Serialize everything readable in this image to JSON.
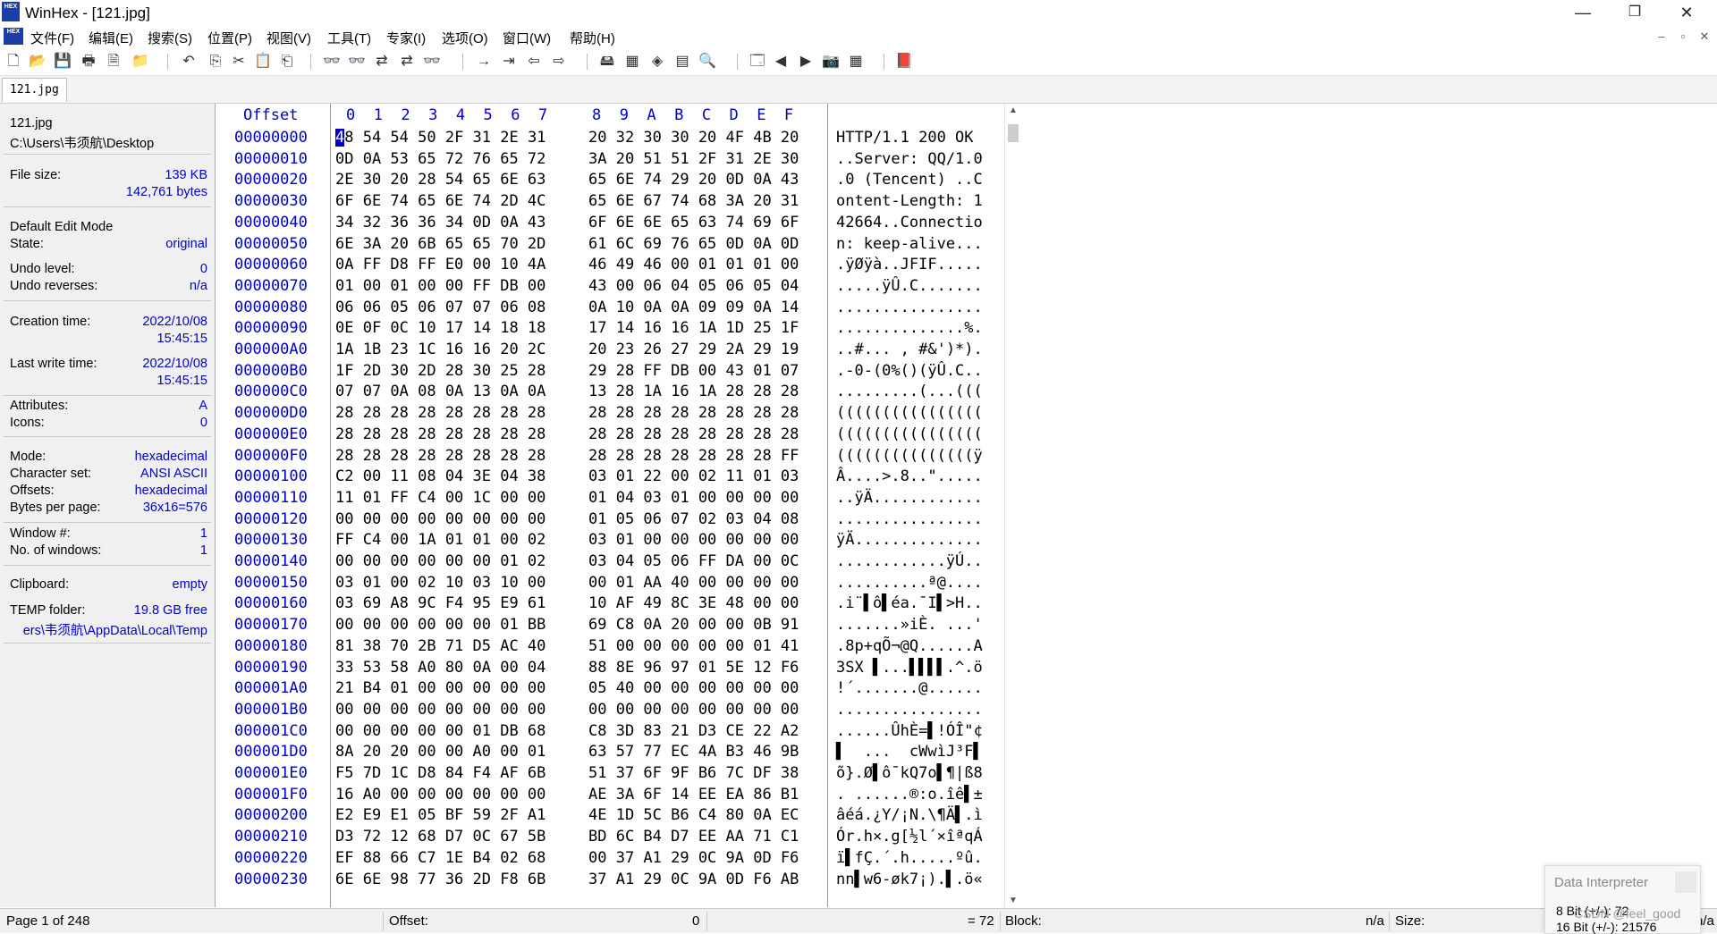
{
  "window": {
    "app_icon_text": "HEX",
    "title": "WinHex - [121.jpg]",
    "minimize": "—",
    "restore": "❐",
    "close": "✕"
  },
  "menu": {
    "items": [
      "文件(F)",
      "编辑(E)",
      "搜索(S)",
      "位置(P)",
      "视图(V)",
      "工具(T)",
      "专家(I)",
      "选项(O)",
      "窗口(W)",
      "帮助(H)"
    ],
    "mdi_min": "–",
    "mdi_restore": "▫",
    "mdi_close": "✕"
  },
  "toolbar": {
    "icons": [
      "new-file-icon",
      "open-file-icon",
      "save-icon",
      "print-icon",
      "properties-icon",
      "open-folder-icon",
      "undo-icon",
      "copy-icon",
      "cut-icon",
      "paste-icon",
      "copy-hex-icon",
      "find-text-icon",
      "find-hex-icon",
      "replace-text-icon",
      "replace-hex-icon",
      "find-again-icon",
      "goto-offset-icon",
      "goto-sector-icon",
      "back-icon",
      "forward-icon",
      "open-disk-icon",
      "open-ram-icon",
      "disk-tools-icon",
      "calculator-icon",
      "analyze-icon",
      "disk-snapshot-icon",
      "prev-icon",
      "next-icon",
      "camera-icon",
      "grid-icon",
      "help-book-icon"
    ],
    "glyphs": [
      "🗋",
      "📂",
      "💾",
      "🖶",
      "🗎",
      "📁",
      "↶",
      "⎘",
      "✂",
      "📋",
      "⎗",
      "👓",
      "👓",
      "⇄",
      "⇄",
      "👓",
      "→",
      "⇥",
      "⇦",
      "⇨",
      "🖴",
      "▦",
      "◈",
      "▤",
      "🔍",
      "🗔",
      "◀",
      "▶",
      "📷",
      "▦",
      "📕"
    ]
  },
  "tab": {
    "label": "121.jpg"
  },
  "info_panel": {
    "file_name": "121.jpg",
    "file_path": "C:\\Users\\韦须航\\Desktop",
    "file_size_label": "File size:",
    "file_size_kb": "139 KB",
    "file_size_bytes": "142,761 bytes",
    "edit_mode_label": "Default Edit Mode",
    "state_label": "State:",
    "state_value": "original",
    "undo_level_label": "Undo level:",
    "undo_level_value": "0",
    "undo_reverses_label": "Undo reverses:",
    "undo_reverses_value": "n/a",
    "creation_time_label": "Creation time:",
    "creation_date": "2022/10/08",
    "creation_time": "15:45:15",
    "last_write_label": "Last write time:",
    "last_write_date": "2022/10/08",
    "last_write_time": "15:45:15",
    "attributes_label": "Attributes:",
    "attributes_value": "A",
    "icons_label": "Icons:",
    "icons_value": "0",
    "mode_label": "Mode:",
    "mode_value": "hexadecimal",
    "charset_label": "Character set:",
    "charset_value": "ANSI ASCII",
    "offsets_label": "Offsets:",
    "offsets_value": "hexadecimal",
    "bpp_label": "Bytes per page:",
    "bpp_value": "36x16=576",
    "window_label": "Window #:",
    "window_value": "1",
    "num_windows_label": "No. of windows:",
    "num_windows_value": "1",
    "clipboard_label": "Clipboard:",
    "clipboard_value": "empty",
    "temp_label": "TEMP folder:",
    "temp_value": "19.8 GB free",
    "temp_path": "ers\\韦须航\\AppData\\Local\\Temp"
  },
  "hex_header": {
    "offset": "Offset",
    "columns_a": [
      "0",
      "1",
      "2",
      "3",
      "4",
      "5",
      "6",
      "7"
    ],
    "columns_b": [
      "8",
      "9",
      "A",
      "B",
      "C",
      "D",
      "E",
      "F"
    ]
  },
  "hex_rows": [
    {
      "offset": "00000000",
      "a": "48 54 54 50 2F 31 2E 31",
      "b": "20 32 30 30 20 4F 4B 20",
      "text": "HTTP/1.1 200 OK "
    },
    {
      "offset": "00000010",
      "a": "0D 0A 53 65 72 76 65 72",
      "b": "3A 20 51 51 2F 31 2E 30",
      "text": "..Server: QQ/1.0"
    },
    {
      "offset": "00000020",
      "a": "2E 30 20 28 54 65 6E 63",
      "b": "65 6E 74 29 20 0D 0A 43",
      "text": ".0 (Tencent) ..C"
    },
    {
      "offset": "00000030",
      "a": "6F 6E 74 65 6E 74 2D 4C",
      "b": "65 6E 67 74 68 3A 20 31",
      "text": "ontent-Length: 1"
    },
    {
      "offset": "00000040",
      "a": "34 32 36 36 34 0D 0A 43",
      "b": "6F 6E 6E 65 63 74 69 6F",
      "text": "42664..Connectio"
    },
    {
      "offset": "00000050",
      "a": "6E 3A 20 6B 65 65 70 2D",
      "b": "61 6C 69 76 65 0D 0A 0D",
      "text": "n: keep-alive..."
    },
    {
      "offset": "00000060",
      "a": "0A FF D8 FF E0 00 10 4A",
      "b": "46 49 46 00 01 01 01 00",
      "text": ".ÿØÿà..JFIF....."
    },
    {
      "offset": "00000070",
      "a": "01 00 01 00 00 FF DB 00",
      "b": "43 00 06 04 05 06 05 04",
      "text": ".....ÿÛ.C......."
    },
    {
      "offset": "00000080",
      "a": "06 06 05 06 07 07 06 08",
      "b": "0A 10 0A 0A 09 09 0A 14",
      "text": "................"
    },
    {
      "offset": "00000090",
      "a": "0E 0F 0C 10 17 14 18 18",
      "b": "17 14 16 16 1A 1D 25 1F",
      "text": "..............%."
    },
    {
      "offset": "000000A0",
      "a": "1A 1B 23 1C 16 16 20 2C",
      "b": "20 23 26 27 29 2A 29 19",
      "text": "..#... , #&')*)."
    },
    {
      "offset": "000000B0",
      "a": "1F 2D 30 2D 28 30 25 28",
      "b": "29 28 FF DB 00 43 01 07",
      "text": ".-0-(0%()(ÿÛ.C.."
    },
    {
      "offset": "000000C0",
      "a": "07 07 0A 08 0A 13 0A 0A",
      "b": "13 28 1A 16 1A 28 28 28",
      "text": ".........(...((("
    },
    {
      "offset": "000000D0",
      "a": "28 28 28 28 28 28 28 28",
      "b": "28 28 28 28 28 28 28 28",
      "text": "(((((((((((((((("
    },
    {
      "offset": "000000E0",
      "a": "28 28 28 28 28 28 28 28",
      "b": "28 28 28 28 28 28 28 28",
      "text": "(((((((((((((((("
    },
    {
      "offset": "000000F0",
      "a": "28 28 28 28 28 28 28 28",
      "b": "28 28 28 28 28 28 28 FF",
      "text": "(((((((((((((((ÿ"
    },
    {
      "offset": "00000100",
      "a": "C2 00 11 08 04 3E 04 38",
      "b": "03 01 22 00 02 11 01 03",
      "text": "Â....>.8..\"....."
    },
    {
      "offset": "00000110",
      "a": "11 01 FF C4 00 1C 00 00",
      "b": "01 04 03 01 00 00 00 00",
      "text": "..ÿÄ............"
    },
    {
      "offset": "00000120",
      "a": "00 00 00 00 00 00 00 00",
      "b": "01 05 06 07 02 03 04 08",
      "text": "................"
    },
    {
      "offset": "00000130",
      "a": "FF C4 00 1A 01 01 00 02",
      "b": "03 01 00 00 00 00 00 00",
      "text": "ÿÄ.............."
    },
    {
      "offset": "00000140",
      "a": "00 00 00 00 00 00 01 02",
      "b": "03 04 05 06 FF DA 00 0C",
      "text": "............ÿÚ.."
    },
    {
      "offset": "00000150",
      "a": "03 01 00 02 10 03 10 00",
      "b": "00 01 AA 40 00 00 00 00",
      "text": "..........ª@...."
    },
    {
      "offset": "00000160",
      "a": "03 69 A8 9C F4 95 E9 61",
      "b": "10 AF 49 8C 3E 48 00 00",
      "text": ".i¨▌ô▌éa.¯I▌>H.."
    },
    {
      "offset": "00000170",
      "a": "00 00 00 00 00 00 01 BB",
      "b": "69 C8 0A 20 00 00 0B 91",
      "text": ".......»iÈ. ...'"
    },
    {
      "offset": "00000180",
      "a": "81 38 70 2B 71 D5 AC 40",
      "b": "51 00 00 00 00 00 01 41",
      "text": ".8p+qÕ¬@Q......A"
    },
    {
      "offset": "00000190",
      "a": "33 53 58 A0 80 0A 00 04",
      "b": "88 8E 96 97 01 5E 12 F6",
      "text": "3SX ▌...▌▌▌▌.^.ö"
    },
    {
      "offset": "000001A0",
      "a": "21 B4 01 00 00 00 00 00",
      "b": "05 40 00 00 00 00 00 00",
      "text": "!´.......@......"
    },
    {
      "offset": "000001B0",
      "a": "00 00 00 00 00 00 00 00",
      "b": "00 00 00 00 00 00 00 00",
      "text": "................"
    },
    {
      "offset": "000001C0",
      "a": "00 00 00 00 00 01 DB 68",
      "b": "C8 3D 83 21 D3 CE 22 A2",
      "text": "......ÛhÈ=▌!ÓÎ\"¢"
    },
    {
      "offset": "000001D0",
      "a": "8A 20 20 00 00 A0 00 01",
      "b": "63 57 77 EC 4A B3 46 9B",
      "text": "▌  ...  cWwìJ³F▌"
    },
    {
      "offset": "000001E0",
      "a": "F5 7D 1C D8 84 F4 AF 6B",
      "b": "51 37 6F 9F B6 7C DF 38",
      "text": "õ}.Ø▌ô¯kQ7o▌¶|ß8"
    },
    {
      "offset": "000001F0",
      "a": "16 A0 00 00 00 00 00 00",
      "b": "AE 3A 6F 14 EE EA 86 B1",
      "text": ". ......®:o.îê▌±"
    },
    {
      "offset": "00000200",
      "a": "E2 E9 E1 05 BF 59 2F A1",
      "b": "4E 1D 5C B6 C4 80 0A EC",
      "text": "âéá.¿Y/¡N.\\¶Ä▌.ì"
    },
    {
      "offset": "00000210",
      "a": "D3 72 12 68 D7 0C 67 5B",
      "b": "BD 6C B4 D7 EE AA 71 C1",
      "text": "Ór.h×.g[½l´×îªqÁ"
    },
    {
      "offset": "00000220",
      "a": "EF 88 66 C7 1E B4 02 68",
      "b": "00 37 A1 29 0C 9A 0D F6",
      "text": "ï▌fÇ.´.h.....ºû."
    },
    {
      "offset": "00000230",
      "a": "6E 6E 98 77 36 2D F8 6B",
      "b": "37 A1 29 0C 9A 0D F6 AB",
      "text": "nn▌w6-øk7¡).▌.ö«"
    }
  ],
  "status": {
    "page": "Page 1 of 248",
    "offset_label": "Offset:",
    "offset_value": "0",
    "eq_value": "= 72",
    "block_label": "Block:",
    "block_value": "n/a",
    "size_label": "Size:",
    "size_value": "n/a"
  },
  "data_interpreter": {
    "title": "Data Interpreter",
    "row1": "8 Bit (+/-): 72",
    "row2": "16 Bit (+/-): 21576"
  },
  "watermark": "CSDN @feel_good"
}
